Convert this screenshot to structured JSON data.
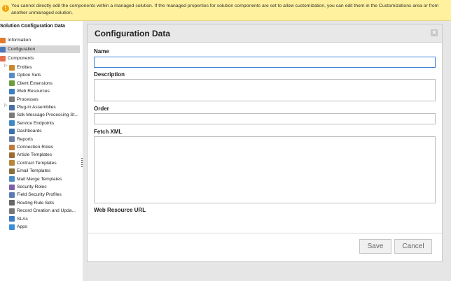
{
  "warning": {
    "icon": "warning-icon",
    "text": "You cannot directly edit the components within a managed solution. If the managed properties for solution components are set to allow customization, you can edit them in the Customizations area or from another unmanaged solution."
  },
  "nav": {
    "title": "Solution Configuration Data",
    "information": "Information",
    "configuration": "Configuration",
    "components": "Components",
    "items": [
      {
        "label": "Entities",
        "icon": "entities-icon",
        "color": "#c9872c"
      },
      {
        "label": "Option Sets",
        "icon": "option-sets-icon",
        "color": "#5a8bc6"
      },
      {
        "label": "Client Extensions",
        "icon": "client-extensions-icon",
        "color": "#6b9e3c"
      },
      {
        "label": "Web Resources",
        "icon": "web-resources-icon",
        "color": "#3d7dc2"
      },
      {
        "label": "Processes",
        "icon": "processes-icon",
        "color": "#7a7a7a"
      },
      {
        "label": "Plug-in Assemblies",
        "icon": "plugin-assemblies-icon",
        "color": "#4a6fa5"
      },
      {
        "label": "Sdk Message Processing St...",
        "icon": "sdk-message-icon",
        "color": "#7b7b7b"
      },
      {
        "label": "Service Endpoints",
        "icon": "service-endpoints-icon",
        "color": "#3f88c5"
      },
      {
        "label": "Dashboards",
        "icon": "dashboards-icon",
        "color": "#3d6fb0"
      },
      {
        "label": "Reports",
        "icon": "reports-icon",
        "color": "#6a7fa8"
      },
      {
        "label": "Connection Roles",
        "icon": "connection-roles-icon",
        "color": "#c07b3a"
      },
      {
        "label": "Article Templates",
        "icon": "article-templates-icon",
        "color": "#a06b32"
      },
      {
        "label": "Contract Templates",
        "icon": "contract-templates-icon",
        "color": "#b5873a"
      },
      {
        "label": "Email Templates",
        "icon": "email-templates-icon",
        "color": "#8a6d3b"
      },
      {
        "label": "Mail Merge Templates",
        "icon": "mail-merge-templates-icon",
        "color": "#4d8cc4"
      },
      {
        "label": "Security Roles",
        "icon": "security-roles-icon",
        "color": "#7c5fa8"
      },
      {
        "label": "Field Security Profiles",
        "icon": "field-security-profiles-icon",
        "color": "#5b7bb5"
      },
      {
        "label": "Routing Rule Sets",
        "icon": "routing-rule-sets-icon",
        "color": "#666666"
      },
      {
        "label": "Record Creation and Upda...",
        "icon": "record-creation-icon",
        "color": "#777777"
      },
      {
        "label": "SLAs",
        "icon": "slas-icon",
        "color": "#3f7cc8"
      },
      {
        "label": "Apps",
        "icon": "apps-icon",
        "color": "#3a8fd8"
      }
    ]
  },
  "dialog": {
    "title": "Configuration Data",
    "close_icon": "close-icon",
    "name_label": "Name",
    "name_value": "",
    "description_label": "Description",
    "description_value": "",
    "order_label": "Order",
    "order_value": "",
    "fetch_label": "Fetch XML",
    "fetch_value": "",
    "web_resource_label": "Web Resource URL",
    "save_label": "Save",
    "cancel_label": "Cancel"
  }
}
